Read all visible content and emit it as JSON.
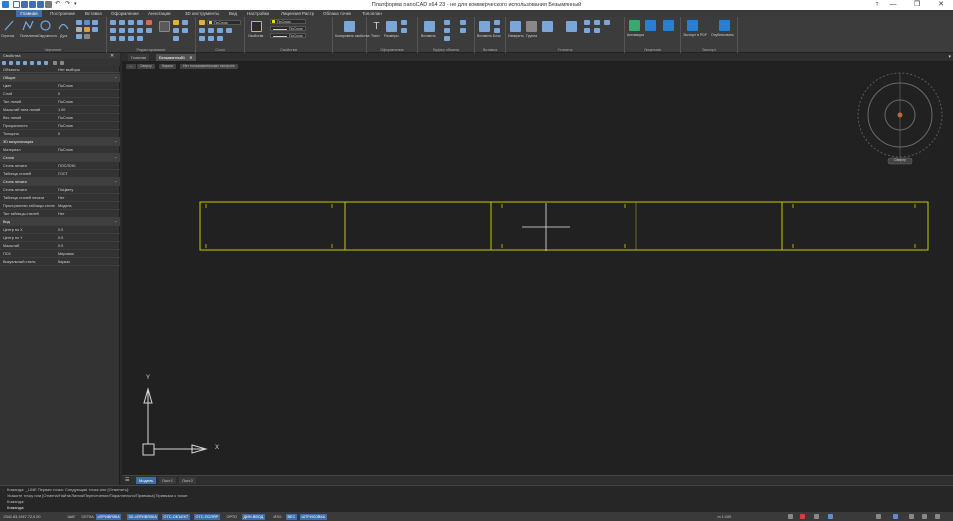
{
  "window": {
    "title": "Платформа nanoCAD x64 23 - не для коммерческого использования Безымянный",
    "controls": [
      "—",
      "❐",
      "✕"
    ],
    "app_icon": "nanocad-logo-icon",
    "help_icon": "question-icon"
  },
  "menu_tabs": [
    "Главная",
    "Построение",
    "Вставка",
    "Оформление",
    "Аннотации",
    "3D инструменты",
    "Вид",
    "Настройки",
    "Лицензия",
    "Растр",
    "Облака точек",
    "Топоплан"
  ],
  "active_menu_tab": 0,
  "ribbon_groups": [
    {
      "label": "Черчение"
    },
    {
      "label": "Редактирование"
    },
    {
      "label": "Свойства"
    },
    {
      "label": "Слои"
    },
    {
      "label": "Оформление"
    },
    {
      "label": "Буфер обмена"
    },
    {
      "label": "Вставка"
    },
    {
      "label": "Утилиты"
    },
    {
      "label": "Лицензия"
    },
    {
      "label": "Экспорт"
    }
  ],
  "ribbon_labels": {
    "otrezok": "Отрезок",
    "polilinia": "Полилиния",
    "okruzhnost": "Окружность",
    "dugа": "Дуга",
    "layer_name": "0",
    "by_layer": "ПоСлою",
    "props_button": "Свойства",
    "match": "Копировать свойства",
    "text": "Текст",
    "dimensions": "Размеры",
    "insert": "Вставить",
    "block": "Вставить Блок",
    "measure": "Измерить",
    "group": "Группа",
    "licence": "Активация",
    "export1": "Экспорт в PDF",
    "export2": "Опубликовать"
  },
  "properties_panel": {
    "header": "Свойства",
    "object_selector": "Объекты",
    "object_value": "Нет выбора",
    "sections": [
      {
        "title": "Общие",
        "rows": [
          {
            "k": "Цвет",
            "v": "ПоСлою"
          },
          {
            "k": "Слой",
            "v": "0"
          },
          {
            "k": "Тип линий",
            "v": "ПоСлою"
          },
          {
            "k": "Масштаб типа линий",
            "v": "1.00"
          },
          {
            "k": "Вес линий",
            "v": "ПоСлою"
          },
          {
            "k": "Прозрачность",
            "v": "ПоСлою"
          },
          {
            "k": "Толщина",
            "v": "0"
          }
        ]
      },
      {
        "title": "3D визуализация",
        "rows": [
          {
            "k": "Материал",
            "v": "ПоСлою"
          }
        ]
      },
      {
        "title": "Стили",
        "rows": [
          {
            "k": "Стиль печати",
            "v": "ПОСЛОЮ"
          },
          {
            "k": "Таблица стилей",
            "v": "ГОСТ"
          }
        ]
      },
      {
        "title": "Стиль печати",
        "rows": [
          {
            "k": "Стиль печати",
            "v": "ПоЦвету"
          },
          {
            "k": "Таблица стилей печати",
            "v": "Нет"
          },
          {
            "k": "Пространство таблицы стилей",
            "v": "Модель"
          },
          {
            "k": "Тип таблицы стилей",
            "v": "Нет"
          }
        ]
      },
      {
        "title": "Вид",
        "rows": [
          {
            "k": "Центр по X",
            "v": "0.0"
          },
          {
            "k": "Центр по Y",
            "v": "0.0"
          },
          {
            "k": "Масштаб",
            "v": "0.0"
          },
          {
            "k": "ПСК",
            "v": "Мировая"
          },
          {
            "k": "Визуальный стиль",
            "v": "Каркас"
          }
        ]
      }
    ]
  },
  "document_tabs": [
    "Главная",
    "Безымянный1"
  ],
  "active_doc_tab": 1,
  "view_controls": [
    "—",
    "Сверху",
    "Каркас",
    "Нет пользовательских настроек"
  ],
  "compass": {
    "label": "Сверху"
  },
  "ucs": {
    "x": "X",
    "y": "Y"
  },
  "layout_tabs": [
    "Модель",
    "Лист1",
    "Лист2"
  ],
  "active_layout_tab": 0,
  "command_lines": [
    "Команда: _LINE Первая точка: Следующая точка или [Отменить]:",
    "Укажите точку или [Отмена/Найти/Линия/Пересечение/Параллельно/Привязка] Привязка к точке:",
    "Команда:",
    "Команда:"
  ],
  "status_bar": {
    "coords": "2341.63,1947.72,0.00",
    "buttons": [
      {
        "t": "ШАГ",
        "on": false
      },
      {
        "t": "СЕТКА",
        "on": false
      },
      {
        "t": "оПРИВЯЗКА",
        "on": true
      },
      {
        "t": "3D-оПРИВЯЗКА",
        "on": true
      },
      {
        "t": "ОТС-ОБЪЕКТ",
        "on": true
      },
      {
        "t": "ОТС-ПОЛЯР",
        "on": true
      },
      {
        "t": "ОРТО",
        "on": false
      },
      {
        "t": "ДИН-ВВОД",
        "on": true
      },
      {
        "t": "ИЗО",
        "on": false
      },
      {
        "t": "ВЕС",
        "on": true
      },
      {
        "t": "ШТРИХОВКА",
        "on": true
      }
    ],
    "scale": "m 1:100",
    "right_icons": [
      "grid-icon",
      "lock-icon",
      "monitor-icon",
      "settings-icon",
      "fullscreen-icon"
    ]
  }
}
